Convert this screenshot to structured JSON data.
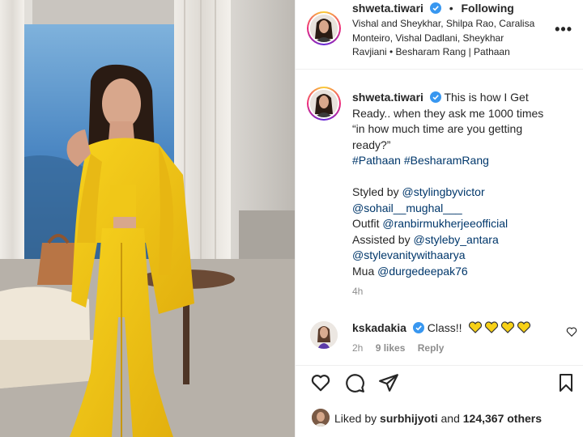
{
  "post": {
    "username": "shweta.tiwari",
    "follow_status": "Following",
    "separator": "•",
    "audio": "Vishal and Sheykhar, Shilpa Rao, Caralisa Monteiro, Vishal Dadlani, Sheykhar Ravjiani • Besharam Rang | Pathaan"
  },
  "caption": {
    "username": "shweta.tiwari",
    "line1": "This is how I Get",
    "line2": "Ready.. when they ask me 1000 times",
    "line3": "“in how much time are you getting",
    "line4": "ready?”",
    "hashtags": "#Pathaan #BesharamRang",
    "styled_by_label": "Styled by",
    "styled_by_1": "@stylingbyvictor",
    "styled_by_2": "@sohail__mughal___",
    "outfit_label": "Outfit",
    "outfit_handle": "@ranbirmukherjeeofficial",
    "assisted_label": "Assisted by",
    "assisted_handle_1": "@styleby_antara",
    "assisted_handle_2": "@stylevanitywithaarya",
    "mua_label": "Mua",
    "mua_handle": "@durgedeepak76",
    "time": "4h"
  },
  "comment": {
    "username": "kskadakia",
    "text": "Class!!",
    "time": "2h",
    "likes": "9 likes",
    "reply": "Reply"
  },
  "likes_bar": {
    "prefix": "Liked by",
    "user": "surbhijyoti",
    "joiner": "and",
    "others": "124,367 others"
  },
  "colors": {
    "suit_yellow": "#f2c21a",
    "link_blue": "#00376b",
    "verified_blue": "#3897f0",
    "muted": "#8e8e8e"
  }
}
